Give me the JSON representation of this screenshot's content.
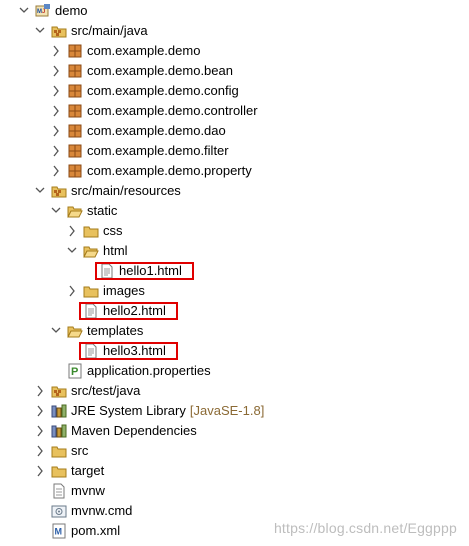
{
  "tree": {
    "rows": [
      {
        "name": "project-demo",
        "label": "demo",
        "icon": "project-icon",
        "twisty": "expanded"
      },
      {
        "name": "src-main-java",
        "label": "src/main/java",
        "icon": "source-folder-icon",
        "twisty": "expanded"
      },
      {
        "name": "pkg-demo",
        "label": "com.example.demo",
        "icon": "package-icon",
        "twisty": "collapsed"
      },
      {
        "name": "pkg-bean",
        "label": "com.example.demo.bean",
        "icon": "package-icon",
        "twisty": "collapsed"
      },
      {
        "name": "pkg-config",
        "label": "com.example.demo.config",
        "icon": "package-icon",
        "twisty": "collapsed"
      },
      {
        "name": "pkg-controller",
        "label": "com.example.demo.controller",
        "icon": "package-icon",
        "twisty": "collapsed"
      },
      {
        "name": "pkg-dao",
        "label": "com.example.demo.dao",
        "icon": "package-icon",
        "twisty": "collapsed"
      },
      {
        "name": "pkg-filter",
        "label": "com.example.demo.filter",
        "icon": "package-icon",
        "twisty": "collapsed"
      },
      {
        "name": "pkg-property",
        "label": "com.example.demo.property",
        "icon": "package-icon",
        "twisty": "collapsed"
      },
      {
        "name": "src-main-resources",
        "label": "src/main/resources",
        "icon": "source-folder-icon",
        "twisty": "expanded"
      },
      {
        "name": "folder-static",
        "label": "static",
        "icon": "folder-open-icon",
        "twisty": "expanded"
      },
      {
        "name": "folder-css",
        "label": "css",
        "icon": "folder-icon",
        "twisty": "collapsed"
      },
      {
        "name": "folder-html",
        "label": "html",
        "icon": "folder-open-icon",
        "twisty": "expanded"
      },
      {
        "name": "file-hello1",
        "label": "hello1.html",
        "icon": "html-file-icon",
        "twisty": "none",
        "highlighted": true
      },
      {
        "name": "folder-images",
        "label": "images",
        "icon": "folder-icon",
        "twisty": "collapsed"
      },
      {
        "name": "file-hello2",
        "label": "hello2.html",
        "icon": "html-file-icon",
        "twisty": "none",
        "highlighted": true
      },
      {
        "name": "folder-templates",
        "label": "templates",
        "icon": "folder-open-icon",
        "twisty": "expanded"
      },
      {
        "name": "file-hello3",
        "label": "hello3.html",
        "icon": "html-file-icon",
        "twisty": "none",
        "highlighted": true
      },
      {
        "name": "file-application-properties",
        "label": "application.properties",
        "icon": "properties-file-icon",
        "twisty": "none"
      },
      {
        "name": "src-test-java",
        "label": "src/test/java",
        "icon": "source-folder-icon",
        "twisty": "collapsed"
      },
      {
        "name": "jre-library",
        "label": "JRE System Library",
        "decoration": "[JavaSE-1.8]",
        "icon": "library-icon",
        "twisty": "collapsed"
      },
      {
        "name": "maven-dependencies",
        "label": "Maven Dependencies",
        "icon": "library-icon",
        "twisty": "collapsed"
      },
      {
        "name": "folder-src",
        "label": "src",
        "icon": "folder-icon",
        "twisty": "collapsed"
      },
      {
        "name": "folder-target",
        "label": "target",
        "icon": "folder-icon",
        "twisty": "collapsed"
      },
      {
        "name": "file-mvnw",
        "label": "mvnw",
        "icon": "text-file-icon",
        "twisty": "none"
      },
      {
        "name": "file-mvnw-cmd",
        "label": "mvnw.cmd",
        "icon": "cmd-file-icon",
        "twisty": "none"
      },
      {
        "name": "file-pom",
        "label": "pom.xml",
        "icon": "xml-file-icon",
        "twisty": "none"
      }
    ]
  },
  "watermark": "https://blog.csdn.net/Eggppp",
  "colors": {
    "highlight_border": "#e00000",
    "folder": "#e8c15e",
    "package": "#b5651d",
    "decoration": "#8b6a35"
  }
}
